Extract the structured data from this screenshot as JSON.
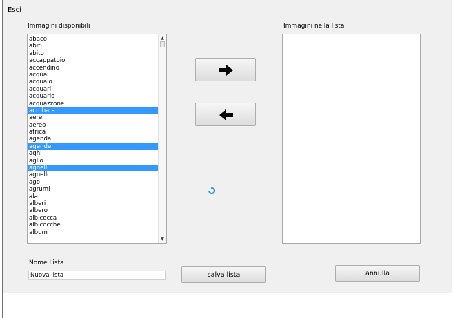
{
  "menu": {
    "esci_label": "Esci"
  },
  "available": {
    "label": "Immagini disponibili",
    "items": [
      {
        "label": "abaco",
        "selected": false
      },
      {
        "label": "abiti",
        "selected": false
      },
      {
        "label": "abito",
        "selected": false
      },
      {
        "label": "accappatoio",
        "selected": false
      },
      {
        "label": "accendino",
        "selected": false
      },
      {
        "label": "acqua",
        "selected": false
      },
      {
        "label": "acquaio",
        "selected": false
      },
      {
        "label": "acquari",
        "selected": false
      },
      {
        "label": "acquario",
        "selected": false
      },
      {
        "label": "acquazzone",
        "selected": false
      },
      {
        "label": "acrobata",
        "selected": true
      },
      {
        "label": "aerei",
        "selected": false
      },
      {
        "label": "aereo",
        "selected": false
      },
      {
        "label": "africa",
        "selected": false
      },
      {
        "label": "agenda",
        "selected": false
      },
      {
        "label": "agende",
        "selected": true
      },
      {
        "label": "aghi",
        "selected": false
      },
      {
        "label": "aglio",
        "selected": false
      },
      {
        "label": "agnelli",
        "selected": true
      },
      {
        "label": "agnello",
        "selected": false
      },
      {
        "label": "ago",
        "selected": false
      },
      {
        "label": "agrumi",
        "selected": false
      },
      {
        "label": "ala",
        "selected": false
      },
      {
        "label": "alberi",
        "selected": false
      },
      {
        "label": "albero",
        "selected": false
      },
      {
        "label": "albicocca",
        "selected": false
      },
      {
        "label": "albicocche",
        "selected": false
      },
      {
        "label": "album",
        "selected": false
      }
    ],
    "selection_color": "#3399ff"
  },
  "in_list": {
    "label": "Immagini nella lista",
    "items": []
  },
  "transfer": {
    "add_icon": "arrow-right-icon",
    "remove_icon": "arrow-left-icon"
  },
  "list_name": {
    "label": "Nome Lista",
    "value": "Nuova lista"
  },
  "actions": {
    "save_label": "salva lista",
    "cancel_label": "annulla"
  },
  "status": {
    "loading_icon": "spinner-icon",
    "spinner_color": "#2a9fd6"
  }
}
